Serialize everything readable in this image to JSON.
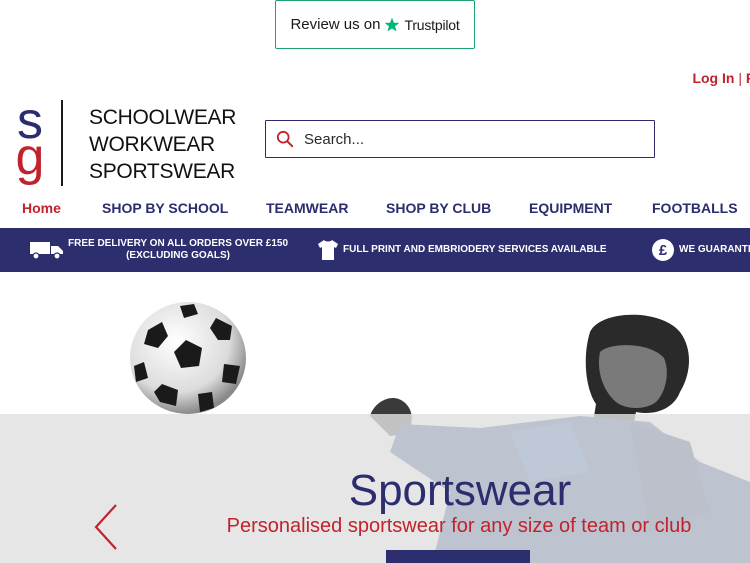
{
  "trustpilot": {
    "prefix": "Review us on",
    "brand": "Trustpilot",
    "accent": "#00b67a"
  },
  "account": {
    "login": "Log In",
    "separator": "|",
    "register": "R"
  },
  "logo": {
    "mark_top": "s",
    "mark_bottom": "g",
    "lines": [
      "SCHOOLWEAR",
      "WORKWEAR",
      "SPORTSWEAR"
    ]
  },
  "search": {
    "placeholder": "Search..."
  },
  "nav": {
    "items": [
      {
        "label": "Home"
      },
      {
        "label": "SHOP BY SCHOOL"
      },
      {
        "label": "TEAMWEAR"
      },
      {
        "label": "SHOP BY CLUB"
      },
      {
        "label": "EQUIPMENT"
      },
      {
        "label": "FOOTBALLS"
      }
    ]
  },
  "infobar": {
    "delivery": {
      "line1": "FREE DELIVERY ON ALL ORDERS OVER £150",
      "line2": "(EXCLUDING GOALS)",
      "icon": "truck-icon"
    },
    "print": {
      "text": "FULL PRINT AND EMBRIODERY SERVICES AVAILABLE",
      "icon": "tshirt-icon"
    },
    "guarantee": {
      "text": "WE GUARANTE",
      "icon": "pound-icon"
    }
  },
  "hero": {
    "title": "Sportswear",
    "subtitle": "Personalised sportswear for any size of team or club"
  },
  "colors": {
    "navy": "#2c2e6e",
    "red": "#c0232c"
  }
}
